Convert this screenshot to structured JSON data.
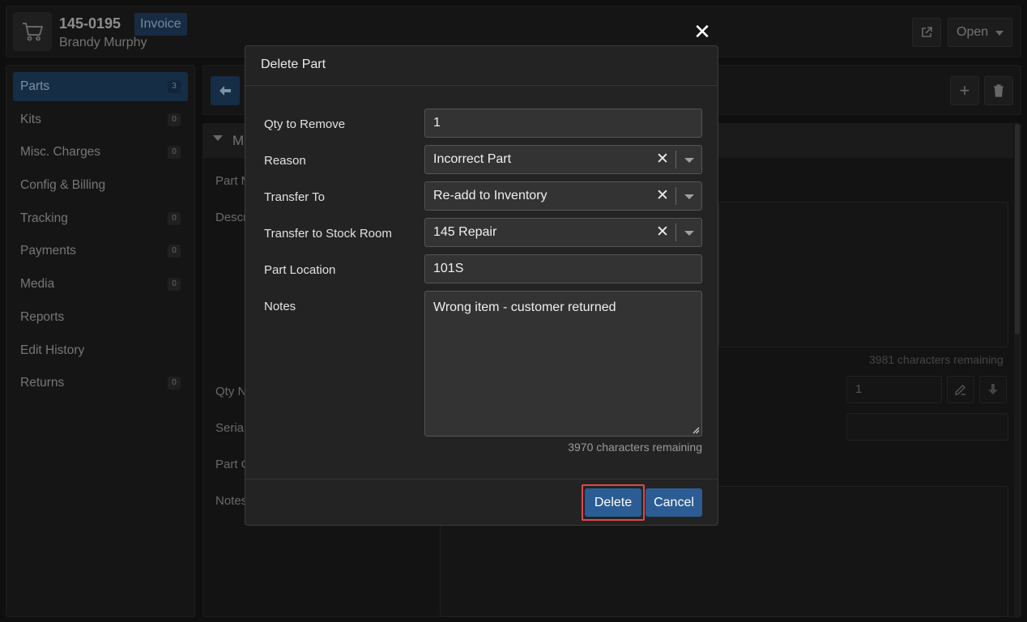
{
  "invoice": {
    "number": "145-0195",
    "badge": "Invoice",
    "customer": "Brandy Murphy",
    "open_label": "Open"
  },
  "sidebar": {
    "items": [
      {
        "label": "Parts",
        "count": "3",
        "active": true
      },
      {
        "label": "Kits",
        "count": "0"
      },
      {
        "label": "Misc. Charges",
        "count": "0"
      },
      {
        "label": "Config & Billing",
        "count": ""
      },
      {
        "label": "Tracking",
        "count": "0"
      },
      {
        "label": "Payments",
        "count": "0"
      },
      {
        "label": "Media",
        "count": "0"
      },
      {
        "label": "Reports",
        "count": ""
      },
      {
        "label": "Edit History",
        "count": ""
      },
      {
        "label": "Returns",
        "count": "0"
      }
    ]
  },
  "background_panel": {
    "header": "M",
    "labels": [
      "Part N",
      "Descr",
      "Qty N",
      "Serial",
      "Part C",
      "Notes"
    ],
    "desc_chars_remaining": "3981 characters remaining",
    "qty_value": "1"
  },
  "modal": {
    "title": "Delete Part",
    "fields": {
      "qty": {
        "label": "Qty to Remove",
        "value": "1"
      },
      "reason": {
        "label": "Reason",
        "value": "Incorrect Part"
      },
      "transfer_to": {
        "label": "Transfer To",
        "value": "Re-add to Inventory"
      },
      "stock_room": {
        "label": "Transfer to Stock Room",
        "value": "145 Repair"
      },
      "location": {
        "label": "Part Location",
        "value": "101S"
      },
      "notes": {
        "label": "Notes",
        "value": "Wrong item - customer returned",
        "chars_remaining": "3970 characters remaining"
      }
    },
    "buttons": {
      "delete": "Delete",
      "cancel": "Cancel"
    }
  },
  "colors": {
    "primary": "#2b5d94",
    "highlight": "#e0474c",
    "active_nav": "#1d3c5c"
  }
}
